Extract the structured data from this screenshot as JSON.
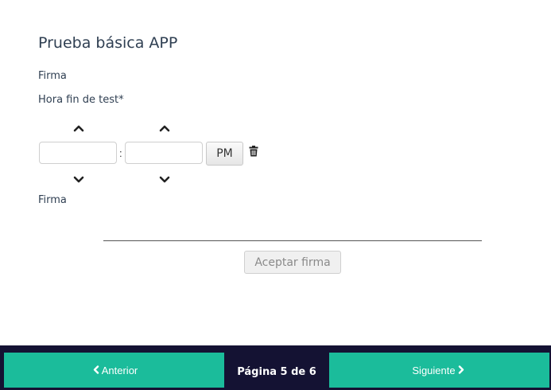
{
  "form": {
    "title": "Prueba básica APP",
    "label_firma_top": "Firma",
    "time_field_label": "Hora fin de test*",
    "time": {
      "hour_value": "",
      "minute_value": "",
      "separator": ":",
      "ampm_label": "PM"
    },
    "label_firma_signature": "Firma",
    "accept_signature_label": "Aceptar firma"
  },
  "footer": {
    "prev_label": "Anterior",
    "next_label": "Siguiente",
    "page_indicator": "Página 5 de 6"
  },
  "colors": {
    "accent": "#1bbc9b",
    "footer_bg": "#141233",
    "title_text": "#2f3f52"
  },
  "icons": {
    "increment": "chevron-up-icon",
    "decrement": "chevron-down-icon",
    "clear": "trash-icon",
    "prev": "chevron-left-icon",
    "next": "chevron-right-icon"
  }
}
